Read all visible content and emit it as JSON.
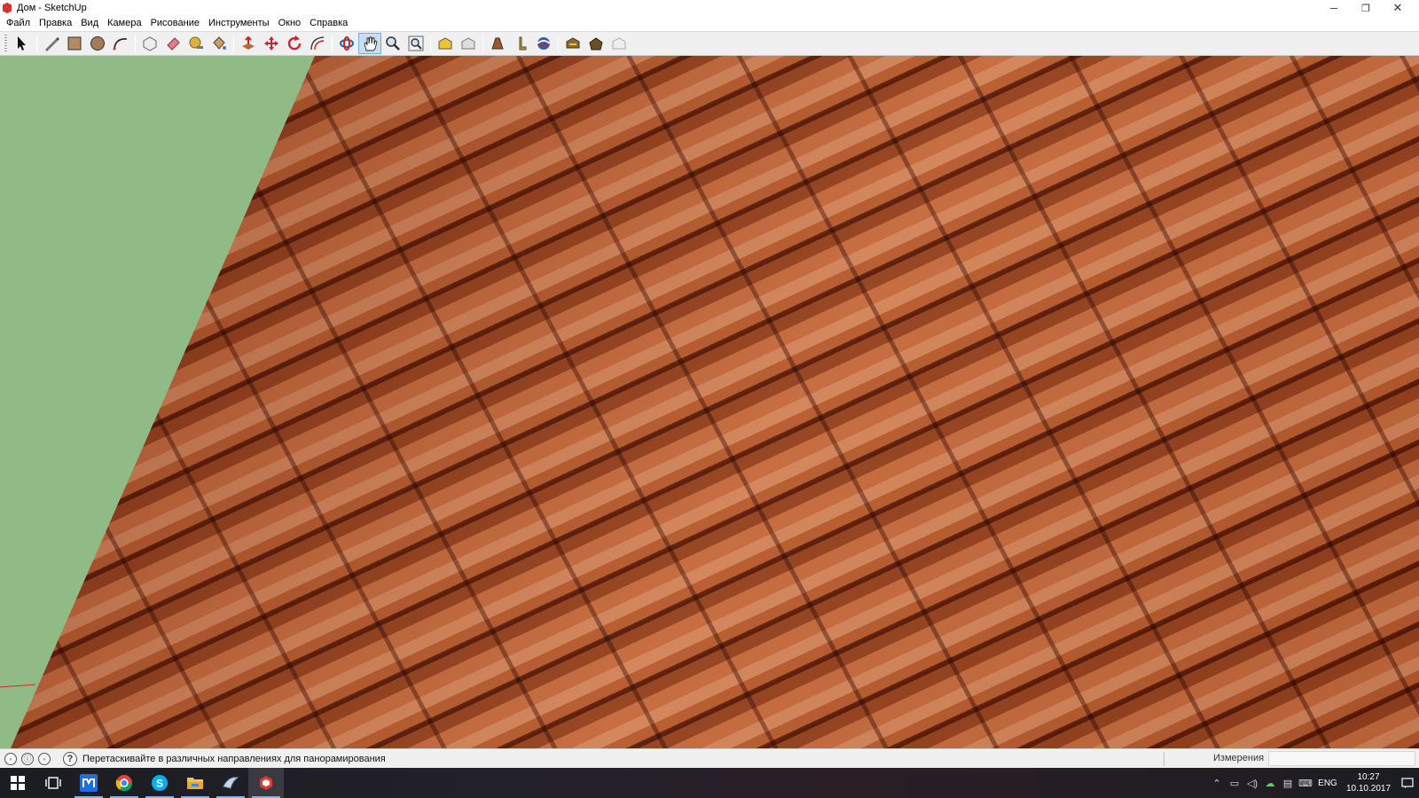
{
  "window": {
    "title": "Дом - SketchUp",
    "controls": {
      "minimize": "─",
      "maximize": "❐",
      "close": "✕"
    }
  },
  "menu": {
    "items": [
      "Файл",
      "Правка",
      "Вид",
      "Камера",
      "Рисование",
      "Инструменты",
      "Окно",
      "Справка"
    ]
  },
  "toolbar": {
    "tools": [
      {
        "name": "select-icon"
      },
      {
        "name": "line-pencil-icon"
      },
      {
        "name": "rectangle-icon"
      },
      {
        "name": "circle-icon"
      },
      {
        "name": "arc-icon"
      },
      {
        "name": "make-component-icon"
      },
      {
        "name": "eraser-icon"
      },
      {
        "name": "tape-measure-icon"
      },
      {
        "name": "paint-bucket-icon"
      },
      {
        "name": "push-pull-icon"
      },
      {
        "name": "move-icon"
      },
      {
        "name": "rotate-icon"
      },
      {
        "name": "offset-icon"
      },
      {
        "name": "orbit-icon"
      },
      {
        "name": "pan-icon"
      },
      {
        "name": "zoom-icon"
      },
      {
        "name": "zoom-extents-icon"
      },
      {
        "name": "warehouse-icon"
      },
      {
        "name": "share-model-icon"
      },
      {
        "name": "extension-warehouse-icon"
      },
      {
        "name": "position-camera-icon"
      },
      {
        "name": "look-around-icon"
      },
      {
        "name": "walk-icon"
      },
      {
        "name": "section-plane-icon"
      }
    ],
    "active_tool": "pan-icon"
  },
  "statusbar": {
    "hint": "Перетаскивайте в различных направлениях для панорамирования",
    "help_glyph": "?",
    "measurements_label": "Измерения",
    "measurements_value": ""
  },
  "taskbar": {
    "apps": [
      {
        "name": "start-icon"
      },
      {
        "name": "task-view-icon"
      },
      {
        "name": "app-m-icon"
      },
      {
        "name": "chrome-icon"
      },
      {
        "name": "skype-icon"
      },
      {
        "name": "file-explorer-icon"
      },
      {
        "name": "app-bird-icon"
      },
      {
        "name": "sketchup-icon"
      }
    ],
    "language": "ENG",
    "time": "10:27",
    "date": "10.10.2017"
  },
  "colors": {
    "ground": "#90bb86",
    "roof_tile": "#c4693d",
    "taskbar": "#1f1e25"
  }
}
